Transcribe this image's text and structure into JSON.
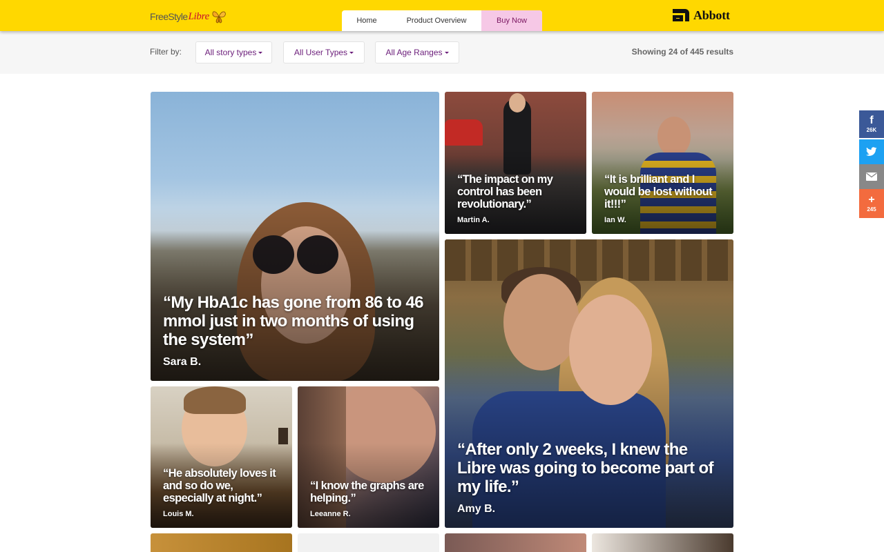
{
  "header": {
    "logo": {
      "part1": "FreeStyle",
      "part2": "Libre"
    },
    "nav": [
      {
        "label": "Home"
      },
      {
        "label": "Product Overview"
      },
      {
        "label": "Buy Now"
      }
    ],
    "brand": "Abbott",
    "brand_color": "#ffd800",
    "buy_now_color": "#f6c8e6"
  },
  "filters": {
    "label": "Filter by:",
    "story_types": "All story types",
    "user_types": "All User Types",
    "age_ranges": "All Age Ranges",
    "results": "Showing 24 of 445 results"
  },
  "stories": {
    "sara": {
      "quote": "“My HbA1c has gone from 86 to 46 mmol just in two months of using the system”",
      "author": "Sara B."
    },
    "martin": {
      "quote": "“The impact on my control has been revolutionary.”",
      "author": "Martin A."
    },
    "ian": {
      "quote": "“It is brilliant and I would be lost without it!!!”",
      "author": "Ian W."
    },
    "louis": {
      "quote": "“He absolutely loves it and so do we, especially at night.”",
      "author": "Louis M."
    },
    "leeanne": {
      "quote": "“I know the graphs are helping.”",
      "author": "Leeanne R."
    },
    "amy": {
      "quote": "“After only 2 weeks, I knew the Libre was going to become part of my life.”",
      "author": "Amy B."
    }
  },
  "share": {
    "facebook": {
      "icon": "facebook-icon",
      "count": "26K",
      "color": "#3b5998"
    },
    "twitter": {
      "icon": "twitter-icon",
      "color": "#1da1f2"
    },
    "email": {
      "icon": "email-icon",
      "color": "#888888"
    },
    "more": {
      "icon": "plus-icon",
      "count": "245",
      "color": "#f36b3e"
    }
  }
}
